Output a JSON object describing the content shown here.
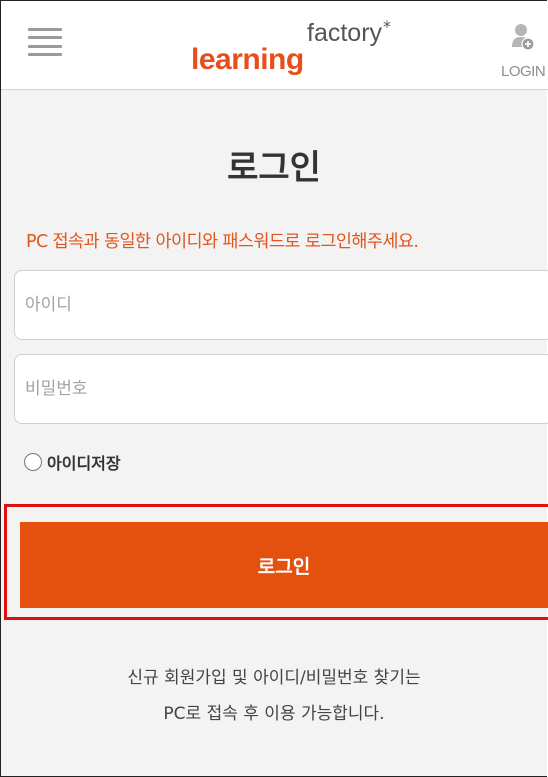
{
  "header": {
    "logo_learning": "learning",
    "logo_factory": "factory",
    "logo_star": "*",
    "login_label": "LOGIN"
  },
  "page": {
    "title": "로그인",
    "notice": "PC 접속과 동일한 아이디와 패스워드로 로그인해주세요."
  },
  "form": {
    "id_placeholder": "아이디",
    "pw_placeholder": "비밀번호",
    "remember_label": "아이디저장",
    "login_button": "로그인"
  },
  "info": {
    "line1": "신규 회원가입 및 아이디/비밀번호 찾기는",
    "line2": "PC로 접속 후 이용 가능합니다."
  },
  "colors": {
    "accent": "#e4510f",
    "notice": "#e2561f",
    "highlight": "#e01010",
    "background": "#f3f3f3"
  },
  "icons": {
    "menu": "hamburger-menu-icon",
    "login": "user-add-icon"
  }
}
